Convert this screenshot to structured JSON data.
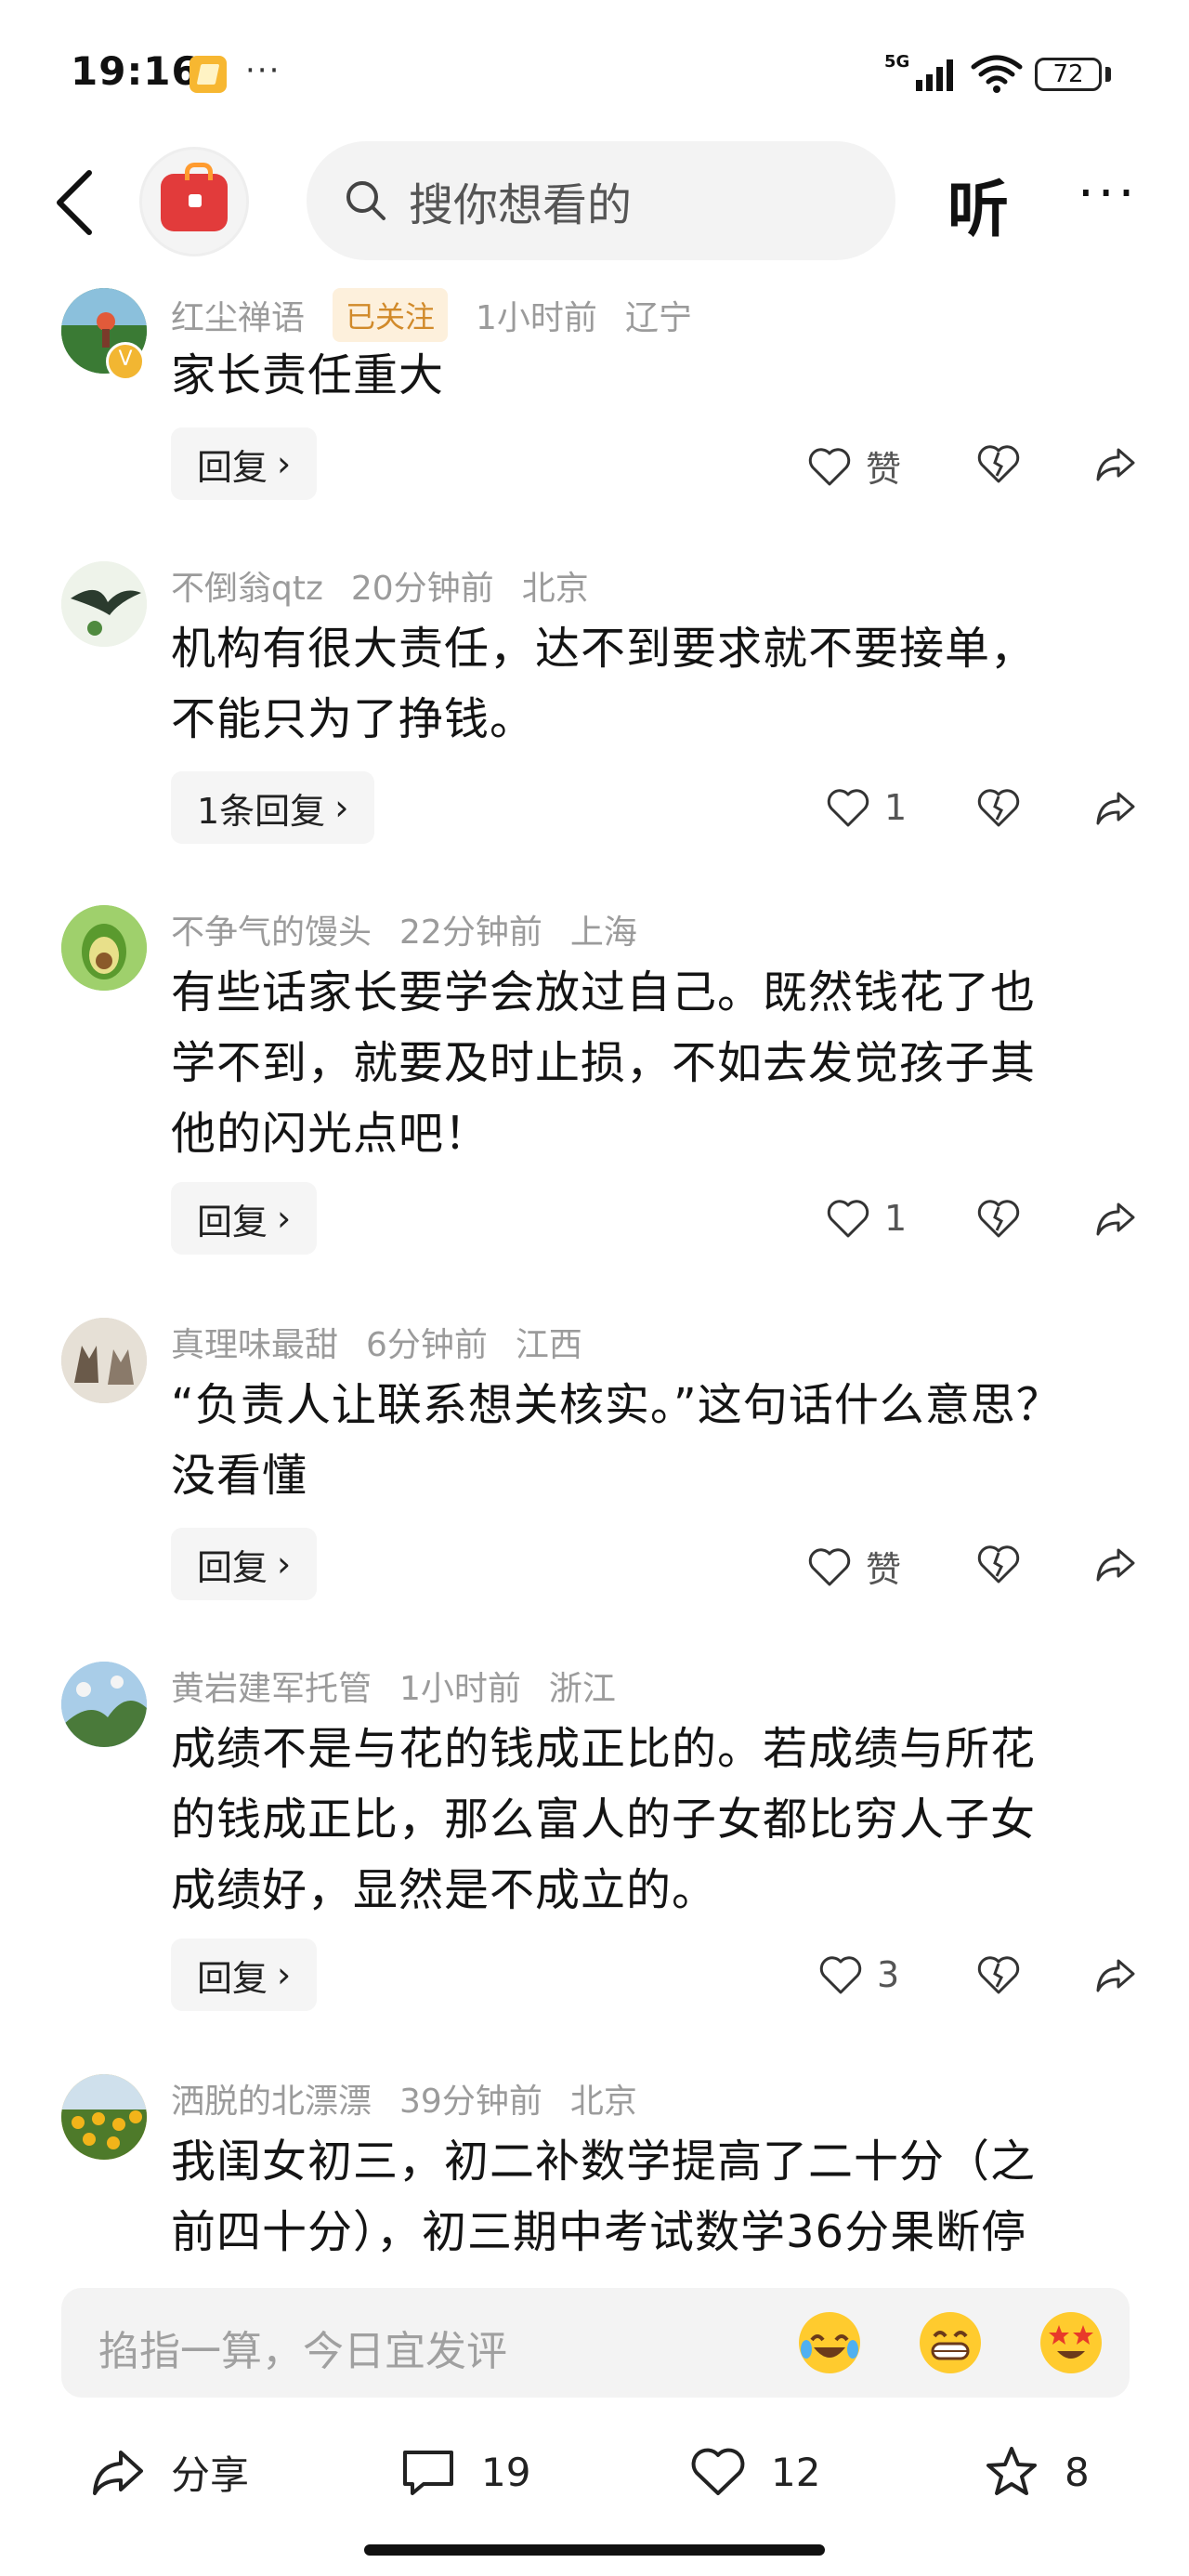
{
  "status_bar": {
    "time": "19:16",
    "more": "···",
    "network": "5G",
    "battery": "72"
  },
  "nav": {
    "search_placeholder": "搜你想看的",
    "listen_label": "听",
    "more_label": "···"
  },
  "comments": [
    {
      "username": "红尘禅语",
      "badge": "已关注",
      "time": "1小时前",
      "location": "辽宁",
      "lines": [
        "家长责任重大"
      ],
      "reply_label": "回复",
      "likes": "赞"
    },
    {
      "username": "不倒翁qtz",
      "time": "20分钟前",
      "location": "北京",
      "lines": [
        "机构有很大责任，达不到要求就不要接单，",
        "不能只为了挣钱。"
      ],
      "reply_label": "1条回复",
      "likes": "1"
    },
    {
      "username": "不争气的馒头",
      "time": "22分钟前",
      "location": "上海",
      "lines": [
        "有些话家长要学会放过自己。既然钱花了也",
        "学不到，就要及时止损，不如去发觉孩子其",
        "他的闪光点吧！"
      ],
      "reply_label": "回复",
      "likes": "1"
    },
    {
      "username": "真理味最甜",
      "time": "6分钟前",
      "location": "江西",
      "lines": [
        "“负责人让联系想关核实。”这句话什么意思？",
        "没看懂"
      ],
      "reply_label": "回复",
      "likes": "赞"
    },
    {
      "username": "黄岩建军托管",
      "time": "1小时前",
      "location": "浙江",
      "lines": [
        "成绩不是与花的钱成正比的。若成绩与所花",
        "的钱成正比，那么富人的子女都比穷人子女",
        "成绩好，显然是不成立的。"
      ],
      "reply_label": "回复",
      "likes": "3"
    },
    {
      "username": "洒脱的北漂漂",
      "time": "39分钟前",
      "location": "北京",
      "lines": [
        "我闺女初三，初二补数学提高了二十分（之",
        "前四十分），初三期中考试数学36分果断停"
      ]
    }
  ],
  "input": {
    "placeholder": "掐指一算，今日宜发评",
    "emojis": [
      "laughing-crying-emoji",
      "grinning-emoji",
      "star-struck-emoji"
    ]
  },
  "bottom_bar": {
    "share_label": "分享",
    "comment_count": "19",
    "like_count": "12",
    "favorite_count": "8"
  },
  "colors": {
    "accent_badge": "#d18a2a",
    "meta_gray": "#9b9b9b",
    "background": "#ffffff"
  }
}
